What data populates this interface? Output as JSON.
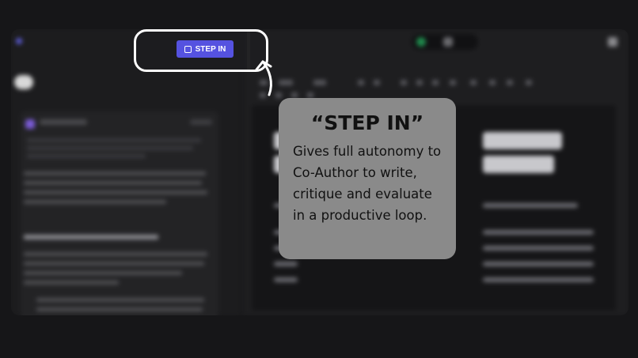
{
  "callout": {
    "title": "“STEP IN”",
    "body": "Gives full autonomy to Co-Author to write, critique and evaluate in a productive loop."
  },
  "button": {
    "label": "STEP IN",
    "icon": "step-in-icon",
    "color": "#5552e0"
  },
  "colors": {
    "background": "#161618",
    "highlight_border": "#ffffff",
    "callout_bg": "#8a8a8a"
  }
}
